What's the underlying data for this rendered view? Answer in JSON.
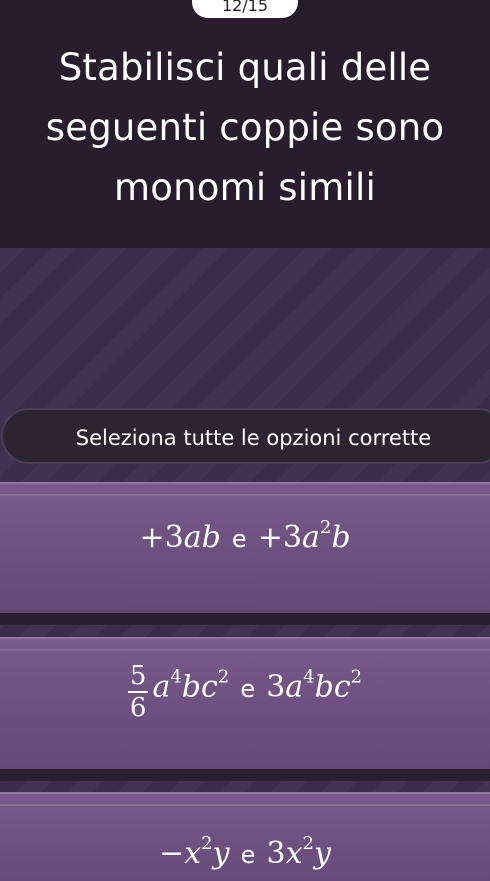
{
  "header": {
    "counter": "12/15",
    "question_line1": "Stabilisci quali delle",
    "question_line2": "seguenti coppie sono",
    "question_line3": "monomi simili"
  },
  "instruction": "Seleziona tutte le opzioni corrette",
  "options": [
    {
      "left": {
        "sign": "+",
        "coef": "3",
        "vars": [
          {
            "v": "ab",
            "e": ""
          }
        ]
      },
      "conj": "e",
      "right": {
        "sign": "+",
        "coef": "3",
        "vars": [
          {
            "v": "a",
            "e": "2"
          },
          {
            "v": "b",
            "e": ""
          }
        ]
      }
    },
    {
      "left": {
        "frac_num": "5",
        "frac_den": "6",
        "vars": [
          {
            "v": "a",
            "e": "4"
          },
          {
            "v": "bc",
            "e": "2"
          }
        ]
      },
      "conj": "e",
      "right": {
        "coef": "3",
        "vars": [
          {
            "v": "a",
            "e": "4"
          },
          {
            "v": "bc",
            "e": "2"
          }
        ]
      }
    },
    {
      "left": {
        "sign": "−",
        "vars": [
          {
            "v": "x",
            "e": "2"
          },
          {
            "v": "y",
            "e": ""
          }
        ]
      },
      "conj": "e",
      "right": {
        "coef": "3",
        "vars": [
          {
            "v": "x",
            "e": "2"
          },
          {
            "v": "y",
            "e": ""
          }
        ]
      }
    }
  ],
  "colors": {
    "header_bg": "#271d2c",
    "option_bg": "#7a5a8c",
    "text": "#ffffff"
  }
}
